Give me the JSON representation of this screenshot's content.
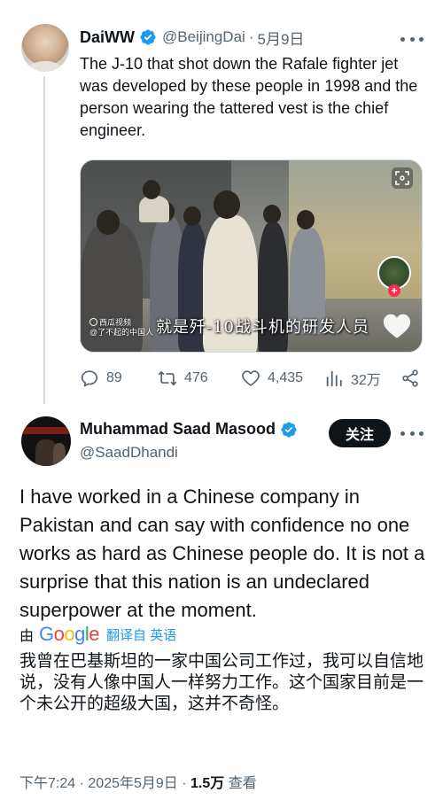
{
  "parent_tweet": {
    "author_name": "DaiWW",
    "handle": "@BeijingDai",
    "date": "5月9日",
    "separator": "·",
    "text": "The J-10 that shot down the Rafale fighter jet was developed by these people in 1998 and the person wearing the tattered vest is the chief engineer.",
    "media": {
      "caption": "就是歼-10战斗机的研发人员",
      "watermark_line1": "西瓜视频",
      "watermark_line2": "@了不起的中国人"
    },
    "actions": {
      "replies": "89",
      "reposts": "476",
      "likes": "4,435",
      "views": "32万"
    }
  },
  "reply_tweet": {
    "author_name": "Muhammad Saad Masood",
    "handle": "@SaadDhandi",
    "follow_label": "关注",
    "text": "I have worked in a Chinese company in Pakistan and can say with confidence no one works as hard as Chinese people do. It is not a surprise that this nation is an undeclared superpower at the moment.",
    "translation": {
      "by_label": "由",
      "provider": "Google",
      "link_label": "翻译自 英语",
      "translated_text": "我曾在巴基斯坦的一家中国公司工作过，我可以自信地说，没有人像中国人一样努力工作。这个国家目前是一个未公开的超级大国，这并不奇怪。"
    },
    "meta": {
      "time": "下午7:24",
      "date": "2025年5月9日",
      "views_count": "1.5万",
      "views_label": "查看",
      "separator": "·"
    }
  },
  "colors": {
    "verified": "#1d9bf0",
    "text_primary": "#0f1419",
    "text_secondary": "#536471",
    "link": "#1d9bf0",
    "follow_button": "#0f1419"
  },
  "icons": [
    "verified-badge-icon",
    "more-icon",
    "expand-icon",
    "reply-icon",
    "repost-icon",
    "like-icon",
    "views-icon",
    "share-icon",
    "heart-overlay-icon"
  ]
}
